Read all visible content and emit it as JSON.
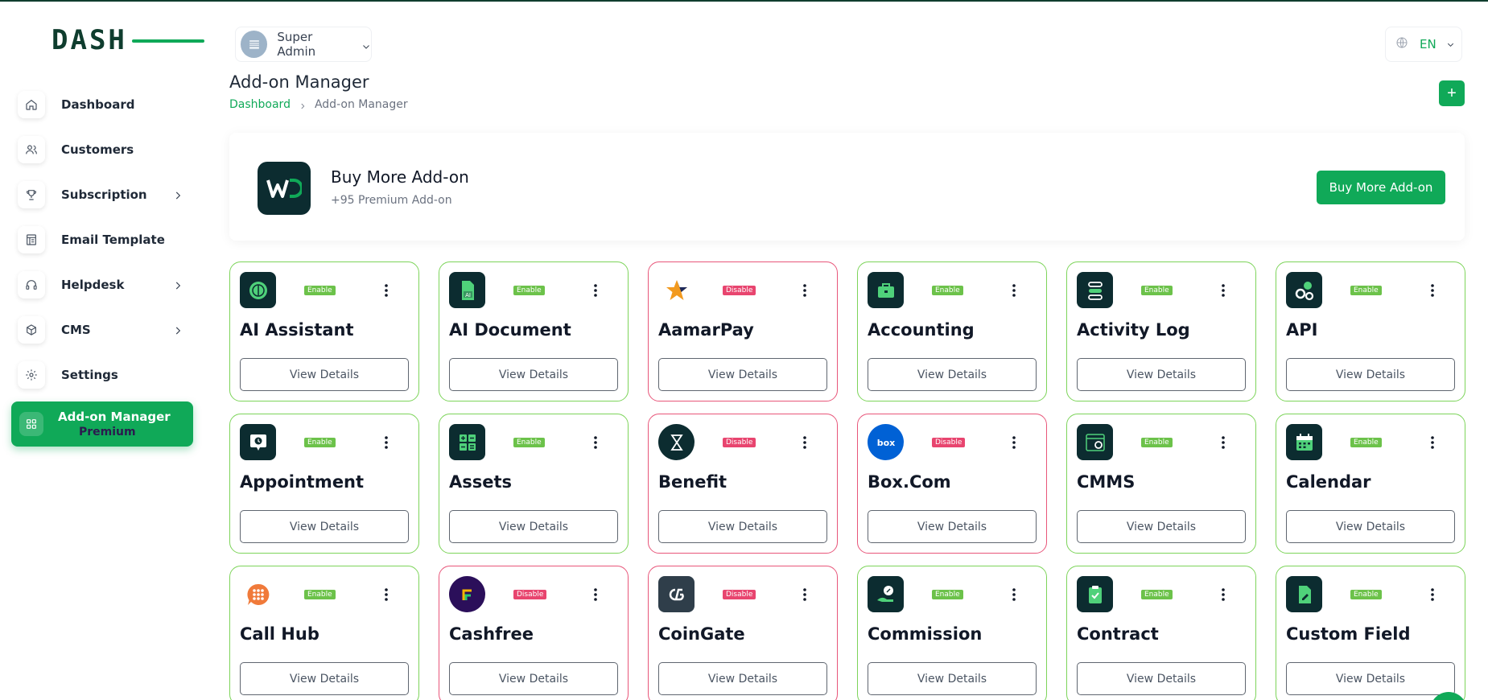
{
  "brand": {
    "logo_text": "DASH"
  },
  "sidebar": {
    "items": [
      {
        "label": "Dashboard",
        "icon": "home-icon",
        "chevron": false
      },
      {
        "label": "Customers",
        "icon": "users-icon",
        "chevron": false
      },
      {
        "label": "Subscription",
        "icon": "trophy-icon",
        "chevron": true
      },
      {
        "label": "Email Template",
        "icon": "template-icon",
        "chevron": false
      },
      {
        "label": "Helpdesk",
        "icon": "headphones-icon",
        "chevron": true
      },
      {
        "label": "CMS",
        "icon": "cube-icon",
        "chevron": true
      },
      {
        "label": "Settings",
        "icon": "gear-icon",
        "chevron": false
      }
    ],
    "active": {
      "label": "Add-on Manager",
      "badge": "Premium",
      "icon": "grid-icon"
    }
  },
  "header": {
    "user_name": "Super Admin",
    "language": "EN"
  },
  "page": {
    "title": "Add-on Manager",
    "breadcrumb": {
      "home": "Dashboard",
      "current": "Add-on Manager"
    },
    "add_label": "+"
  },
  "banner": {
    "title": "Buy More Add-on",
    "subtitle": "+95 Premium Add-on",
    "button_label": "Buy More Add-on"
  },
  "colors": {
    "accent": "#10a958",
    "enabled": "#6cc24a",
    "disabled": "#e8456f",
    "dark_tile": "#0c2c30"
  },
  "labels": {
    "enable": "Enable",
    "disable": "Disable",
    "view_details": "View Details"
  },
  "addons": [
    {
      "name": "AI Assistant",
      "status": "Enable",
      "icon": "ai-assistant-icon"
    },
    {
      "name": "AI Document",
      "status": "Enable",
      "icon": "ai-document-icon"
    },
    {
      "name": "AamarPay",
      "status": "Disable",
      "icon": "aamarpay-star-icon"
    },
    {
      "name": "Accounting",
      "status": "Enable",
      "icon": "briefcase-icon"
    },
    {
      "name": "Activity Log",
      "status": "Enable",
      "icon": "activity-log-icon"
    },
    {
      "name": "API",
      "status": "Enable",
      "icon": "api-gears-icon"
    },
    {
      "name": "Appointment",
      "status": "Enable",
      "icon": "appointment-icon"
    },
    {
      "name": "Assets",
      "status": "Enable",
      "icon": "assets-icon"
    },
    {
      "name": "Benefit",
      "status": "Disable",
      "icon": "hourglass-icon"
    },
    {
      "name": "Box.Com",
      "status": "Disable",
      "icon": "box-logo-icon"
    },
    {
      "name": "CMMS",
      "status": "Enable",
      "icon": "cmms-icon"
    },
    {
      "name": "Calendar",
      "status": "Enable",
      "icon": "calendar-icon"
    },
    {
      "name": "Call Hub",
      "status": "Enable",
      "icon": "call-hub-icon"
    },
    {
      "name": "Cashfree",
      "status": "Disable",
      "icon": "cashfree-icon"
    },
    {
      "name": "CoinGate",
      "status": "Disable",
      "icon": "coingate-icon"
    },
    {
      "name": "Commission",
      "status": "Enable",
      "icon": "commission-icon"
    },
    {
      "name": "Contract",
      "status": "Enable",
      "icon": "contract-icon"
    },
    {
      "name": "Custom Field",
      "status": "Enable",
      "icon": "custom-field-icon"
    }
  ]
}
